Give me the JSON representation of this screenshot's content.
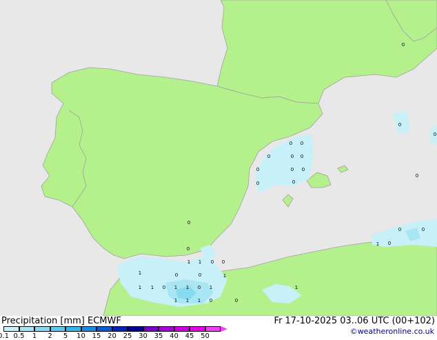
{
  "header": {
    "title_left": "Precipitation [mm]  ECMWF",
    "title_right": "Fr 17-10-2025 03..06 UTC (00+102)",
    "credit": "©weatheronline.co.uk"
  },
  "legend": {
    "ticks": [
      "0.1",
      "0.5",
      "1",
      "2",
      "5",
      "10",
      "15",
      "20",
      "25",
      "30",
      "35",
      "40",
      "45",
      "50"
    ],
    "colors": [
      "#c8f0f8",
      "#a8e6f4",
      "#88daf0",
      "#60c8ec",
      "#38b4e6",
      "#1c8ce0",
      "#0a5ad2",
      "#0024b8",
      "#00008c",
      "#7a00c8",
      "#a800d8",
      "#d000e0",
      "#e800e8",
      "#f040f4"
    ]
  },
  "map": {
    "land_color": "#b4f08c",
    "sea_color": "#e8e8e8",
    "border_color": "#a0a0a0",
    "precip_colors": {
      "light": "#c8f0f8",
      "medium": "#a8e6f4",
      "heavy": "#88daf0"
    },
    "labels": [
      {
        "text": "0"
      },
      {
        "text": "0"
      },
      {
        "text": "0"
      },
      {
        "text": "0"
      },
      {
        "text": "0"
      },
      {
        "text": "0"
      },
      {
        "text": "0"
      },
      {
        "text": "0"
      },
      {
        "text": "0"
      },
      {
        "text": "0"
      },
      {
        "text": "0"
      },
      {
        "text": "0"
      },
      {
        "text": "0"
      },
      {
        "text": "0"
      },
      {
        "text": "0"
      },
      {
        "text": "1"
      },
      {
        "text": "0"
      },
      {
        "text": "1"
      },
      {
        "text": "1"
      },
      {
        "text": "0"
      },
      {
        "text": "0"
      },
      {
        "text": "1"
      },
      {
        "text": "0"
      },
      {
        "text": "0"
      },
      {
        "text": "1"
      },
      {
        "text": "1"
      },
      {
        "text": "0"
      },
      {
        "text": "1"
      },
      {
        "text": "1"
      },
      {
        "text": "0"
      },
      {
        "text": "1"
      },
      {
        "text": "1"
      },
      {
        "text": "1"
      },
      {
        "text": "0"
      },
      {
        "text": "1"
      },
      {
        "text": "1"
      },
      {
        "text": "0"
      },
      {
        "text": "1"
      },
      {
        "text": "0"
      },
      {
        "text": "0"
      },
      {
        "text": "0"
      }
    ]
  }
}
